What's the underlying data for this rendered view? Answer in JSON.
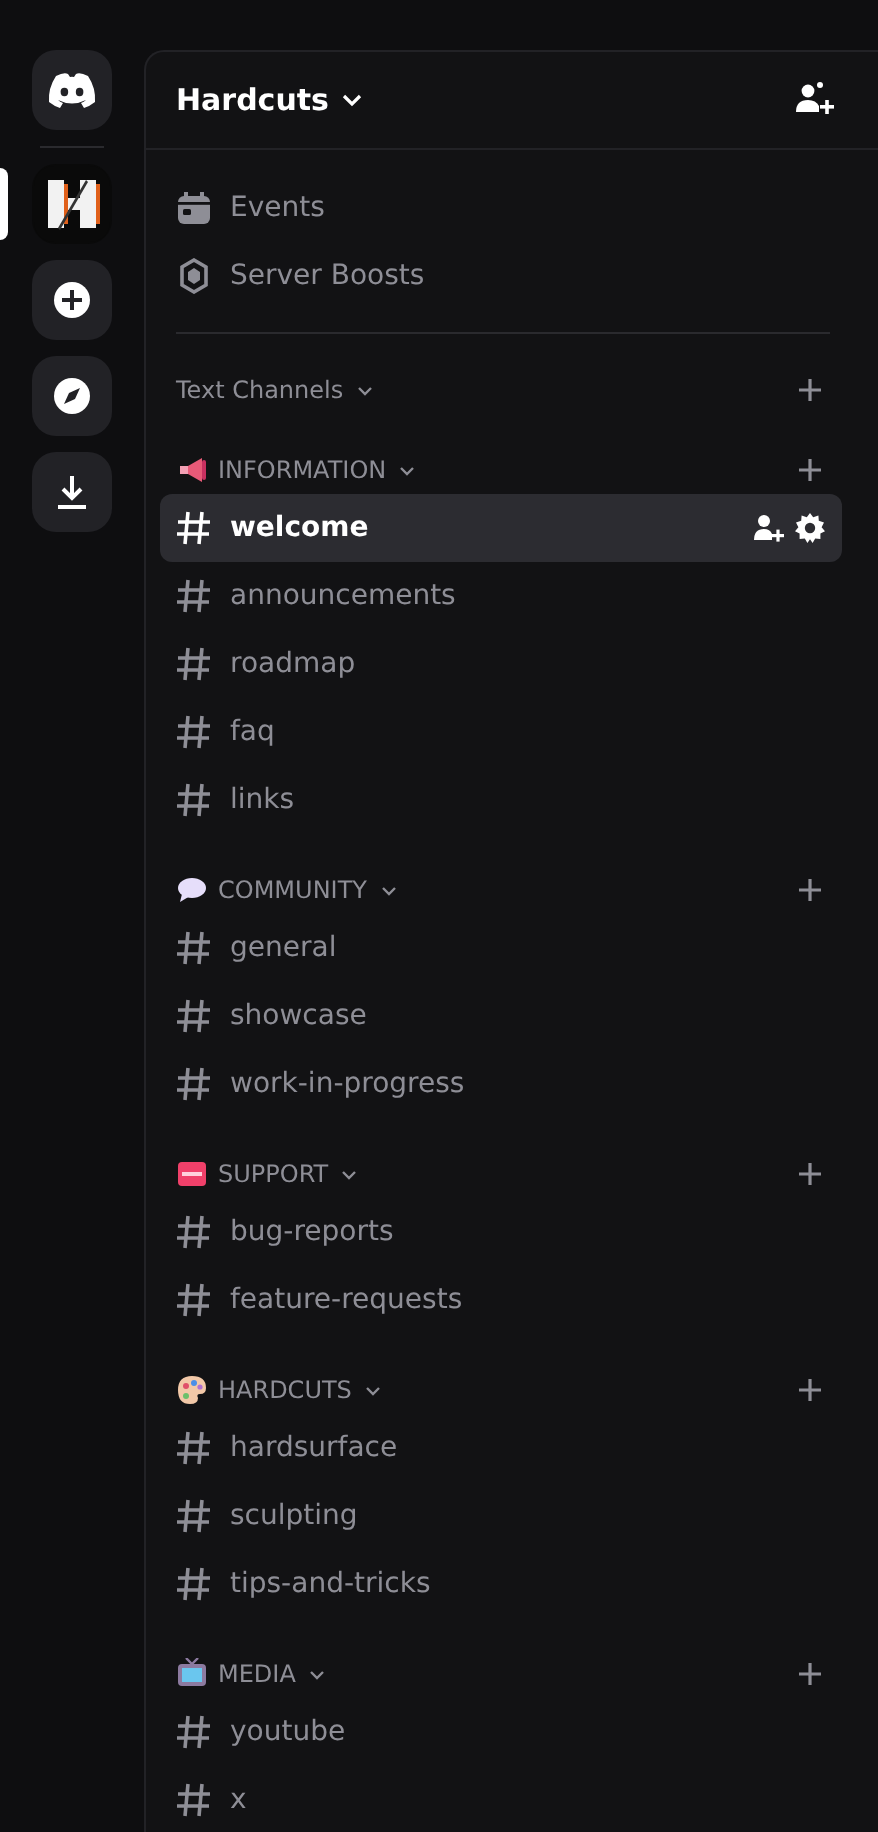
{
  "rail": [
    {
      "kind": "home",
      "selected": false
    },
    {
      "kind": "server",
      "selected": true
    },
    {
      "kind": "add",
      "selected": false
    },
    {
      "kind": "discover",
      "selected": false
    },
    {
      "kind": "download",
      "selected": false
    }
  ],
  "server": {
    "name": "Hardcuts"
  },
  "nav_items": [
    {
      "kind": "events",
      "label": "Events"
    },
    {
      "kind": "boosts",
      "label": "Server Boosts"
    }
  ],
  "categories": [
    {
      "kind": "plain",
      "name": "Text Channels"
    },
    {
      "kind": "megaphone",
      "name": "INFORMATION",
      "channels": [
        {
          "name": "welcome",
          "selected": true
        },
        {
          "name": "announcements",
          "selected": false
        },
        {
          "name": "roadmap",
          "selected": false
        },
        {
          "name": "faq",
          "selected": false
        },
        {
          "name": "links",
          "selected": false
        }
      ]
    },
    {
      "kind": "speech",
      "name": "COMMUNITY",
      "channels": [
        {
          "name": "general",
          "selected": false
        },
        {
          "name": "showcase",
          "selected": false
        },
        {
          "name": "work-in-progress",
          "selected": false
        }
      ]
    },
    {
      "kind": "sos",
      "name": "SUPPORT",
      "channels": [
        {
          "name": "bug-reports",
          "selected": false
        },
        {
          "name": "feature-requests",
          "selected": false
        }
      ]
    },
    {
      "kind": "palette",
      "name": "HARDCUTS",
      "channels": [
        {
          "name": "hardsurface",
          "selected": false
        },
        {
          "name": "sculpting",
          "selected": false
        },
        {
          "name": "tips-and-tricks",
          "selected": false
        }
      ]
    },
    {
      "kind": "tv",
      "name": "MEDIA",
      "channels": [
        {
          "name": "youtube",
          "selected": false
        },
        {
          "name": "x",
          "selected": false
        }
      ]
    }
  ]
}
